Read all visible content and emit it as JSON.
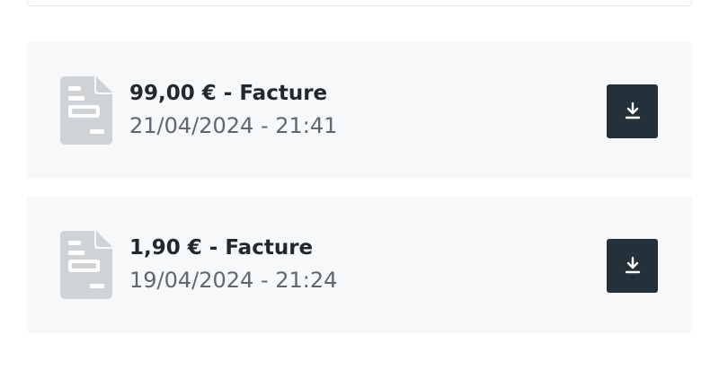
{
  "invoices": [
    {
      "title": "99,00 € - Facture",
      "date": "21/04/2024 - 21:41",
      "icon": "document-icon",
      "action_icon": "download-icon"
    },
    {
      "title": "1,90 € - Facture",
      "date": "19/04/2024 - 21:24",
      "icon": "document-icon",
      "action_icon": "download-icon"
    }
  ],
  "colors": {
    "card_background": "#f7f8fa",
    "button_background": "#25313a",
    "icon_gray": "#d0d3d6",
    "title_text": "#1f282e",
    "date_text": "#5f676d"
  }
}
